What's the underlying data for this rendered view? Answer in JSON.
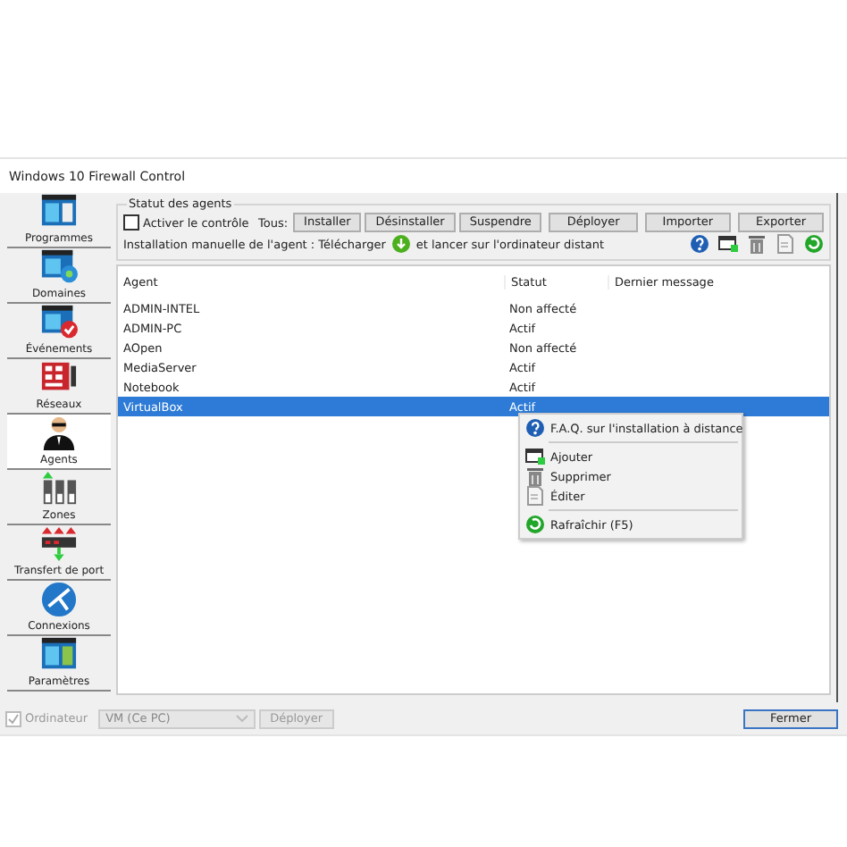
{
  "window": {
    "title": "Windows 10 Firewall Control"
  },
  "sidebar": {
    "items": [
      {
        "label": "Programmes",
        "selected": false
      },
      {
        "label": "Domaines",
        "selected": false
      },
      {
        "label": "Événements",
        "selected": false
      },
      {
        "label": "Réseaux",
        "selected": false
      },
      {
        "label": "Agents",
        "selected": true
      },
      {
        "label": "Zones",
        "selected": false
      },
      {
        "label": "Transfert de port",
        "selected": false
      },
      {
        "label": "Connexions",
        "selected": false
      },
      {
        "label": "Paramètres",
        "selected": false
      }
    ]
  },
  "agents_panel": {
    "group_title": "Statut des agents",
    "enable_control": {
      "label": "Activer le contrôle",
      "checked": false
    },
    "all_label": "Tous:",
    "buttons": [
      "Installer",
      "Désinstaller",
      "Suspendre",
      "Déployer",
      "Importer",
      "Exporter"
    ],
    "manual_install": {
      "before": "Installation manuelle de l'agent : Télécharger",
      "after": "et lancer sur l'ordinateur distant"
    },
    "toolbar": [
      {
        "kind": "help"
      },
      {
        "kind": "add"
      },
      {
        "kind": "delete"
      },
      {
        "kind": "edit"
      },
      {
        "kind": "refresh"
      }
    ],
    "table": {
      "columns": [
        "Agent",
        "Statut",
        "Dernier message"
      ],
      "rows": [
        {
          "agent": "ADMIN-INTEL",
          "status": "Non affecté",
          "selected": false
        },
        {
          "agent": "ADMIN-PC",
          "status": "Actif",
          "selected": false
        },
        {
          "agent": "AOpen",
          "status": "Non affecté",
          "selected": false
        },
        {
          "agent": "MediaServer",
          "status": "Actif",
          "selected": false
        },
        {
          "agent": "Notebook",
          "status": "Actif",
          "selected": false
        },
        {
          "agent": "VirtualBox",
          "status": "Actif",
          "selected": true
        }
      ]
    },
    "context_menu": [
      {
        "kind": "help",
        "label": "F.A.Q. sur l'installation à distance"
      },
      {
        "kind": "separator"
      },
      {
        "kind": "add",
        "label": "Ajouter"
      },
      {
        "kind": "delete",
        "label": "Supprimer"
      },
      {
        "kind": "edit",
        "label": "Éditer"
      },
      {
        "kind": "separator"
      },
      {
        "kind": "refresh",
        "label": "Rafraîchir (F5)"
      }
    ]
  },
  "footer": {
    "computer": {
      "label": "Ordinateur",
      "checked": true,
      "disabled": true
    },
    "computer_select": {
      "value": "VM (Ce PC)",
      "disabled": true
    },
    "deploy_button": {
      "label": "Déployer",
      "disabled": true
    },
    "close_button": {
      "label": "Fermer"
    }
  }
}
